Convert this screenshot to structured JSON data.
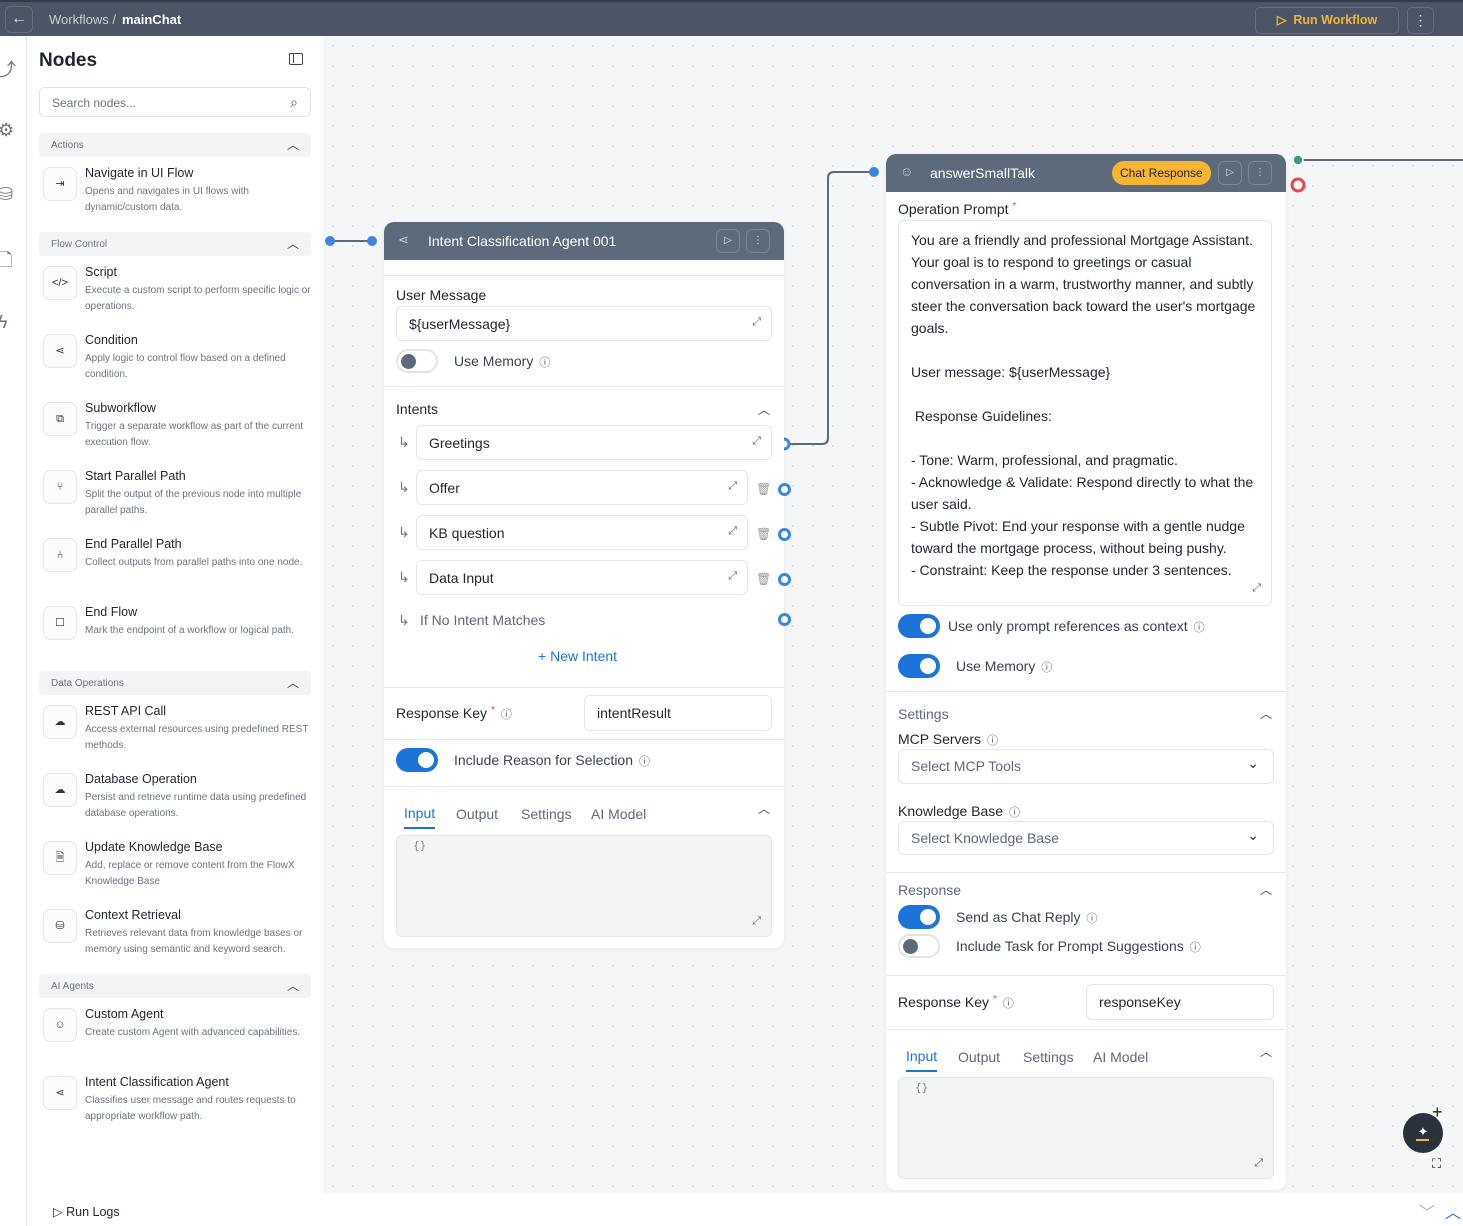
{
  "topbar": {
    "breadcrumb_root": "Workflows",
    "breadcrumb_sep": "/",
    "breadcrumb_current": "mainChat",
    "run_label": "Run Workflow"
  },
  "panel": {
    "title": "Nodes",
    "search_placeholder": "Search nodes...",
    "categories": [
      {
        "label": "Actions",
        "items": [
          {
            "title": "Navigate in UI Flow",
            "desc": "Opens and navigates in UI flows with dynamic/custom data.",
            "icon": "⇥"
          }
        ]
      },
      {
        "label": "Flow Control",
        "items": [
          {
            "title": "Script",
            "desc": "Execute a custom script to perform specific logic or operations.",
            "icon": "</>"
          },
          {
            "title": "Condition",
            "desc": "Apply logic to control flow based on a defined condition.",
            "icon": "⋖"
          },
          {
            "title": "Subworkflow",
            "desc": "Trigger a separate workflow as part of the current execution flow.",
            "icon": "⧉"
          },
          {
            "title": "Start Parallel Path",
            "desc": "Split the output of the previous node into multiple parallel paths.",
            "icon": "⑂"
          },
          {
            "title": "End Parallel Path",
            "desc": "Collect outputs from parallel paths into one node.",
            "icon": "⑃"
          },
          {
            "title": "End Flow",
            "desc": "Mark the endpoint of a workflow or logical path.",
            "icon": "☐"
          }
        ]
      },
      {
        "label": "Data Operations",
        "items": [
          {
            "title": "REST API Call",
            "desc": "Access external resources using predefined REST methods.",
            "icon": "☁"
          },
          {
            "title": "Database Operation",
            "desc": "Persist and retrieve runtime data using predefined database operations.",
            "icon": "☁"
          },
          {
            "title": "Update Knowledge Base",
            "desc": "Add, replace or remove content from the FlowX Knowledge Base",
            "icon": "🗎"
          },
          {
            "title": "Context Retrieval",
            "desc": "Retrieves relevant data from knowledge bases or memory using semantic and keyword search.",
            "icon": "⛁"
          }
        ]
      },
      {
        "label": "AI Agents",
        "items": [
          {
            "title": "Custom Agent",
            "desc": "Create custom Agent with advanced capabilities.",
            "icon": "☺"
          },
          {
            "title": "Intent Classification Agent",
            "desc": "Classifies user message and routes requests to appropriate workflow path.",
            "icon": "⋖"
          }
        ]
      }
    ]
  },
  "bottom": {
    "run_logs": "Run Logs"
  },
  "node1": {
    "title": "Intent Classification Agent 001",
    "user_message_label": "User Message",
    "user_message_value": "${userMessage}",
    "use_memory": "Use Memory",
    "intents_label": "Intents",
    "intents": [
      "Greetings",
      "Offer",
      "KB question",
      "Data Input"
    ],
    "no_match": "If No Intent Matches",
    "new_intent": "New Intent",
    "response_key_label": "Response Key",
    "response_key_value": "intentResult",
    "include_reason": "Include Reason for Selection",
    "tabs": [
      "Input",
      "Output",
      "Settings",
      "AI Model"
    ],
    "code": "{}"
  },
  "node2": {
    "title": "answerSmallTalk",
    "badge": "Chat Response",
    "prompt_label": "Operation Prompt",
    "prompt": "You are a friendly and professional Mortgage Assistant. Your goal is to respond to greetings or casual conversation in a warm, trustworthy manner, and subtly steer the conversation back toward the user's mortgage goals.\n\nUser message: ${userMessage}\n\n Response Guidelines:\n\n- Tone: Warm, professional, and pragmatic.\n- Acknowledge & Validate: Respond directly to what the user said.\n- Subtle Pivot: End your response with a gentle nudge toward the mortgage process, without being pushy.\n- Constraint: Keep the response under 3 sentences.",
    "use_prompt_refs": "Use only prompt references as context",
    "use_memory": "Use Memory",
    "settings_label": "Settings",
    "mcp_label": "MCP Servers",
    "mcp_placeholder": "Select MCP Tools",
    "kb_label": "Knowledge Base",
    "kb_placeholder": "Select Knowledge Base",
    "response_label": "Response",
    "send_chat": "Send as Chat Reply",
    "include_task": "Include Task for Prompt Suggestions",
    "response_key_label": "Response Key",
    "response_key_value": "responseKey",
    "tabs": [
      "Input",
      "Output",
      "Settings",
      "AI Model"
    ],
    "code": "{}"
  },
  "colors": {
    "accent": "#1d74d8",
    "header": "#5d6a7c",
    "badge": "#f7b531",
    "run": "#f5b335"
  }
}
